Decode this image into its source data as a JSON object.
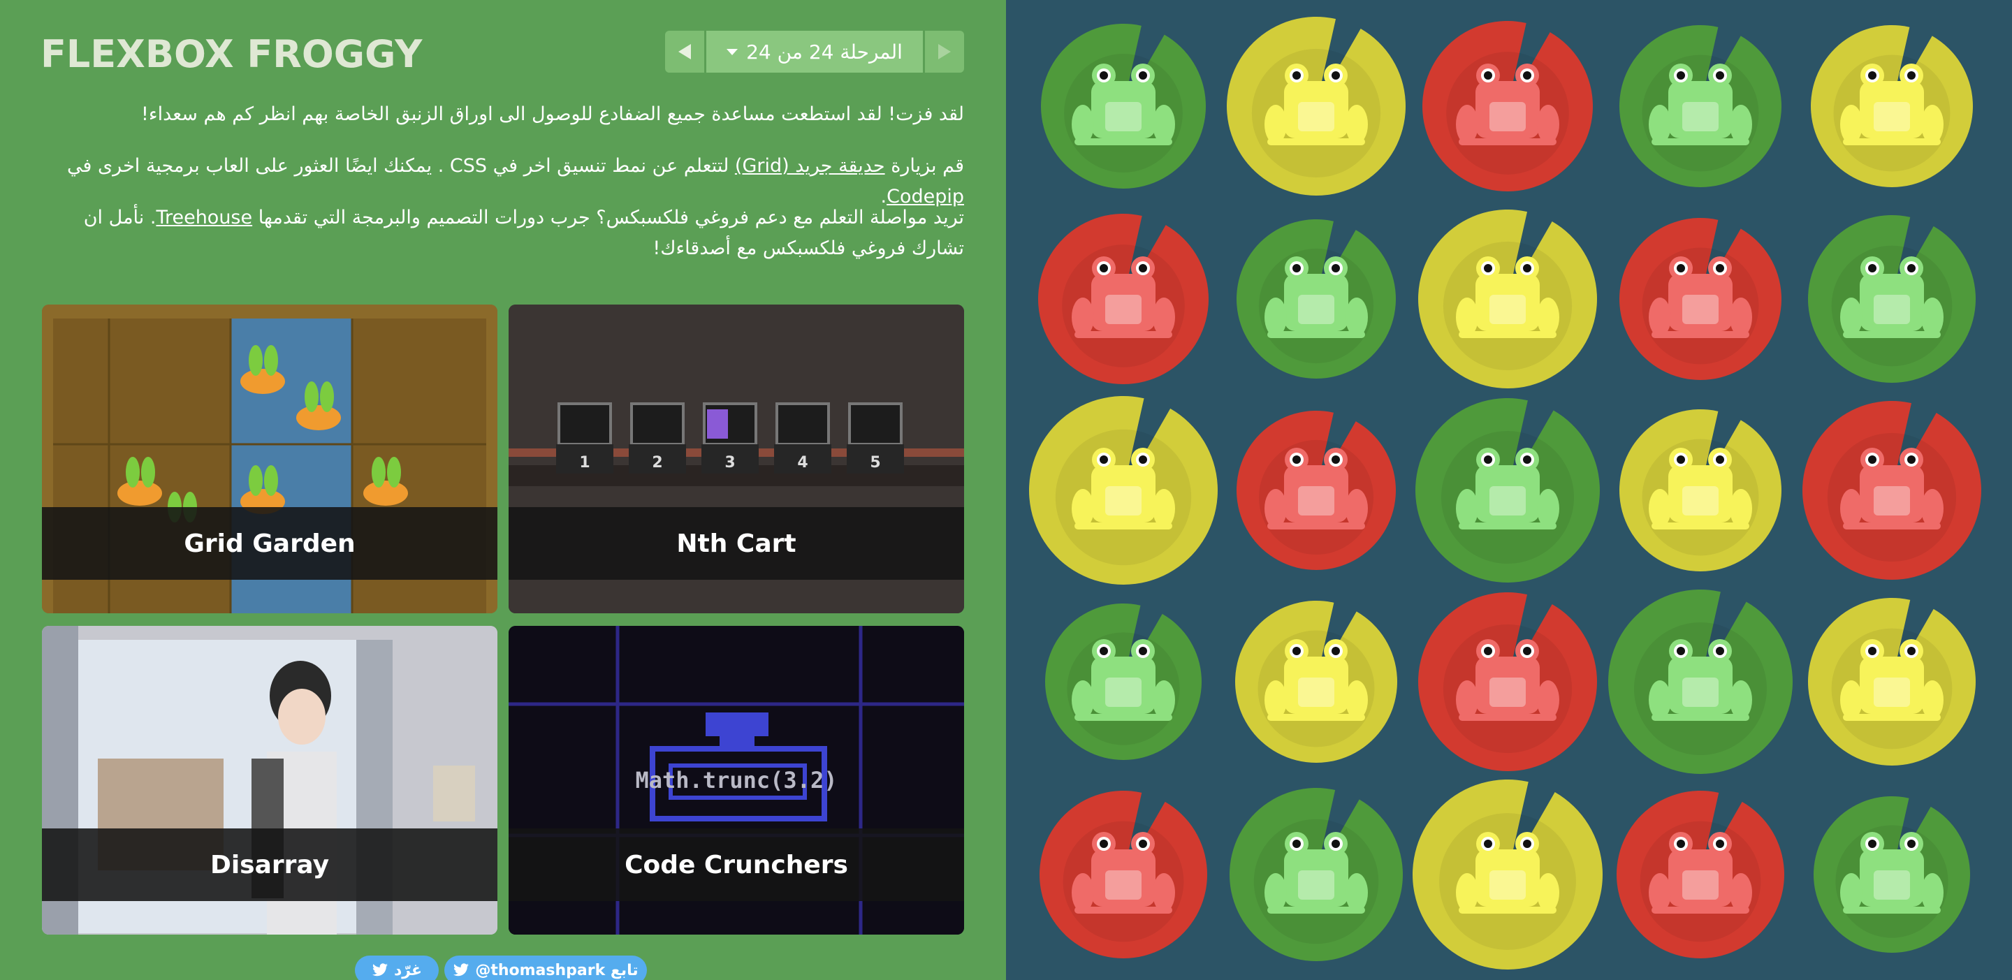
{
  "app": {
    "title": "FLEXBOX FROGGY"
  },
  "nav": {
    "level_text": "المرحلة  24 من 24"
  },
  "text": {
    "p1": "لقد فزت! لقد استطعت مساعدة جميع الضفادع للوصول الى اوراق الزنبق الخاصة بهم انظر كم هم سعداء!",
    "p2_a": "قم بزيارة ",
    "p2_link1": "حديقة جريد (Grid)",
    "p2_b": " لتتعلم عن نمط تنسيق اخر في CSS . يمكنك ايضًا العثور على العاب برمجية اخرى في ",
    "p2_link2": "Codepip",
    "p2_c": ".",
    "p3_a": "تريد مواصلة التعلم مع دعم فروغي فلكسبكس؟ جرب دورات التصميم والبرمجة التي تقدمها ",
    "p3_link": "Treehouse",
    "p3_b": ". نأمل ان تشارك فروغي فلكسبكس مع أصدقاءك!"
  },
  "games": [
    {
      "name": "Grid Garden"
    },
    {
      "name": "Nth Cart"
    },
    {
      "name": "Disarray"
    },
    {
      "name": "Code Crunchers"
    }
  ],
  "cart_numbers": [
    "1",
    "2",
    "3",
    "4",
    "5"
  ],
  "code_text": "Math.trunc(3.2)",
  "share": {
    "tweet_label": "غرّد",
    "follow_label": "@thomashpark تابع"
  },
  "colors": {
    "green_frog": "#8ee07f",
    "green_pad": "#4f9a3b",
    "yellow_frog": "#f7f35a",
    "yellow_pad": "#d2cd3a",
    "red_frog": "#ef6b68",
    "red_pad": "#d23a2f",
    "pond": "#2c5466",
    "panel": "#5b9f55"
  },
  "board": [
    [
      "green",
      "yellow",
      "red",
      "green",
      "yellow"
    ],
    [
      "red",
      "green",
      "yellow",
      "red",
      "green"
    ],
    [
      "yellow",
      "red",
      "green",
      "yellow",
      "red"
    ],
    [
      "green",
      "yellow",
      "red",
      "green",
      "yellow"
    ],
    [
      "red",
      "green",
      "yellow",
      "red",
      "green"
    ]
  ]
}
